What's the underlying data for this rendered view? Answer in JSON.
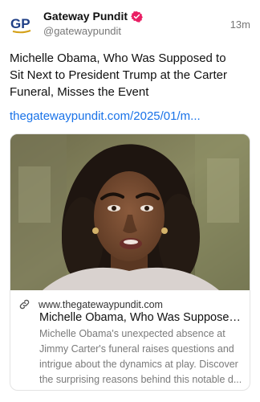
{
  "author": {
    "avatar_text": "GP",
    "display_name": "Gateway Pundit",
    "handle": "@gatewaypundit",
    "timestamp": "13m",
    "verified": true,
    "verified_color": "#e91e63",
    "avatar_colors": {
      "primary": "#1f3f86",
      "accent": "#d4a017"
    }
  },
  "post": {
    "text": "Michelle Obama, Who Was Supposed to Sit Next to President Trump at the Carter Funeral, Misses the Event",
    "link_text": "thegatewaypundit.com/2025/01/m...",
    "link_color": "#1a73e8"
  },
  "card": {
    "image_icon": "photo-woman-portrait",
    "link_icon": "link-icon",
    "domain": "www.thegatewaypundit.com",
    "title": "Michelle Obama, Who Was Supposed ...",
    "description": "Michelle Obama's unexpected absence at Jimmy Carter's funeral raises questions and intrigue about the dynamics at play. Discover the surprising reasons behind this notable d..."
  }
}
